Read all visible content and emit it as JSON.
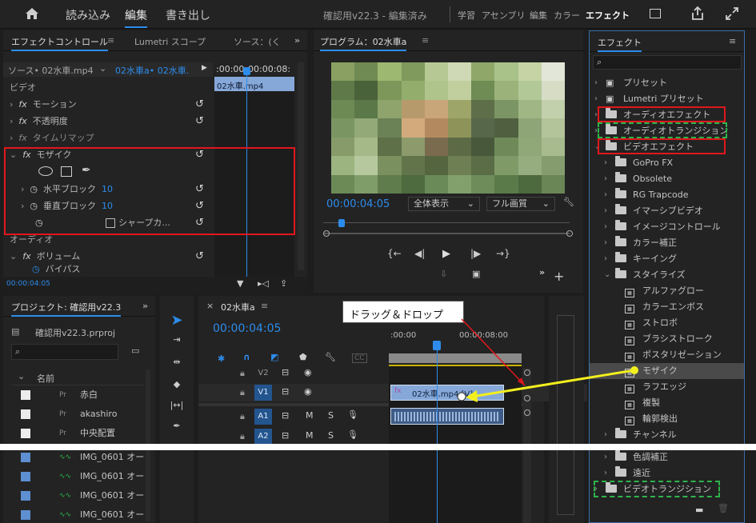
{
  "menu": {
    "home": "home-icon",
    "import": "読み込み",
    "edit": "編集",
    "export": "書き出し",
    "title": "確認用v22.3 - 編集済み",
    "ws": [
      "学習",
      "アセンブリ",
      "編集",
      "カラー",
      "エフェクト"
    ]
  },
  "ec": {
    "tab1": "エフェクトコントロール",
    "tab2": "Lumetri スコープ",
    "tab3": "ソース：(く",
    "src": "ソース• 02水車.mp4",
    "seq": "02水車a• 02水車.",
    "tc_a": ":00:00",
    "tc_b": "00:00:08:",
    "clip": "02水車.mp4",
    "video": "ビデオ",
    "motion": "モーション",
    "opacity": "不透明度",
    "timemap": "タイムリマップ",
    "mosaic": "モザイク",
    "hblock": "水平ブロック",
    "hval": "10",
    "vblock": "垂直ブロック",
    "vval": "10",
    "sharp": "シャープカ...",
    "audio": "オーディオ",
    "volume": "ボリューム",
    "bypass": "バイパス",
    "tc": "00:00:04:05"
  },
  "program": {
    "title": "プログラム：02水車a",
    "tc": "00:00:04:05",
    "fit": "全体表示",
    "quality": "フル画質"
  },
  "project": {
    "title": "プロジェクト: 確認用v22.3",
    "file": "確認用v22.3.prproj",
    "col": "名前",
    "items": [
      "赤白",
      "akashiro",
      "中央配置",
      "IMG_0601 オー",
      "IMG_0601 オー",
      "IMG_0601 オー",
      "IMG_0601 オー"
    ]
  },
  "timeline": {
    "title": "02水車a",
    "tc": "00:00:04:05",
    "r1": ":00:00",
    "r2": "00:00:08:00",
    "tracks": [
      "V2",
      "V1",
      "A1",
      "A2"
    ],
    "clip": "02水車.mp4 [V]",
    "m": "M",
    "s": "S",
    "callout": "ドラッグ＆ドロップ"
  },
  "effects": {
    "title": "エフェクト",
    "items": [
      {
        "label": "プリセット",
        "kind": "fav",
        "ind": 0
      },
      {
        "label": "Lumetri プリセット",
        "kind": "fav",
        "ind": 0
      },
      {
        "label": "オーディオエフェクト",
        "kind": "folder",
        "ind": 0
      },
      {
        "label": "オーディオトランジション",
        "kind": "folder",
        "ind": 0
      },
      {
        "label": "ビデオエフェクト",
        "kind": "folder",
        "ind": 0,
        "open": true
      },
      {
        "label": "GoPro FX",
        "kind": "folder",
        "ind": 1
      },
      {
        "label": "Obsolete",
        "kind": "folder",
        "ind": 1
      },
      {
        "label": "RG Trapcode",
        "kind": "folder",
        "ind": 1
      },
      {
        "label": "イマーシブビデオ",
        "kind": "folder",
        "ind": 1
      },
      {
        "label": "イメージコントロール",
        "kind": "folder",
        "ind": 1
      },
      {
        "label": "カラー補正",
        "kind": "folder",
        "ind": 1
      },
      {
        "label": "キーイング",
        "kind": "folder",
        "ind": 1
      },
      {
        "label": "スタイライズ",
        "kind": "folder",
        "ind": 1,
        "open": true
      },
      {
        "label": "アルファグロー",
        "kind": "fx",
        "ind": 2
      },
      {
        "label": "カラーエンボス",
        "kind": "fx",
        "ind": 2
      },
      {
        "label": "ストロボ",
        "kind": "fx",
        "ind": 2
      },
      {
        "label": "ブラシストローク",
        "kind": "fx",
        "ind": 2
      },
      {
        "label": "ポスタリゼーション",
        "kind": "fx",
        "ind": 2
      },
      {
        "label": "モザイク",
        "kind": "fx",
        "ind": 2,
        "sel": true
      },
      {
        "label": "ラフエッジ",
        "kind": "fx",
        "ind": 2
      },
      {
        "label": "複製",
        "kind": "fx",
        "ind": 2
      },
      {
        "label": "輪郭検出",
        "kind": "fx",
        "ind": 2
      },
      {
        "label": "チャンネル",
        "kind": "folder",
        "ind": 1
      }
    ],
    "after": [
      {
        "label": "色調補正",
        "kind": "folder",
        "ind": 1
      },
      {
        "label": "遠近",
        "kind": "folder",
        "ind": 1
      },
      {
        "label": "ビデオトランジション",
        "kind": "folder",
        "ind": 0
      }
    ]
  },
  "mosaic_colors": [
    "#8aa062",
    "#6f8a52",
    "#9db870",
    "#7f9a5c",
    "#b6c994",
    "#cfd9b5",
    "#8fa86a",
    "#a8c28a",
    "#c6d3a4",
    "#e2e6d8",
    "#5f7a48",
    "#4a6239",
    "#7d9659",
    "#93ad6d",
    "#aec48a",
    "#c1cf9e",
    "#6f8c55",
    "#9bb27a",
    "#b2c897",
    "#d6ddc4",
    "#6d8a55",
    "#5b7848",
    "#8fa46c",
    "#b79a6c",
    "#c9a57a",
    "#9ea568",
    "#5e6e49",
    "#7b9564",
    "#a0b785",
    "#c2d0ab",
    "#7a9562",
    "#93a978",
    "#6b8156",
    "#d2aa7c",
    "#b38a60",
    "#8e9359",
    "#57684a",
    "#4f5f40",
    "#8ea577",
    "#b3c49a",
    "#879b6a",
    "#a4b987",
    "#5d7048",
    "#8c9a6c",
    "#7a6b4e",
    "#5c6a45",
    "#48583b",
    "#6f8a58",
    "#90a877",
    "#a7bb8f",
    "#9cb47f",
    "#b6c99e",
    "#7b905f",
    "#62754a",
    "#54653f",
    "#6e8053",
    "#5a6d47",
    "#809a67",
    "#96ad7f",
    "#859d6e",
    "#6c8a56",
    "#7f9d68",
    "#5f7c4c",
    "#4e6a3f",
    "#6a8a58",
    "#82a06c",
    "#6d8c5a",
    "#5a7a4a",
    "#4c6a3e",
    "#6a8556"
  ]
}
